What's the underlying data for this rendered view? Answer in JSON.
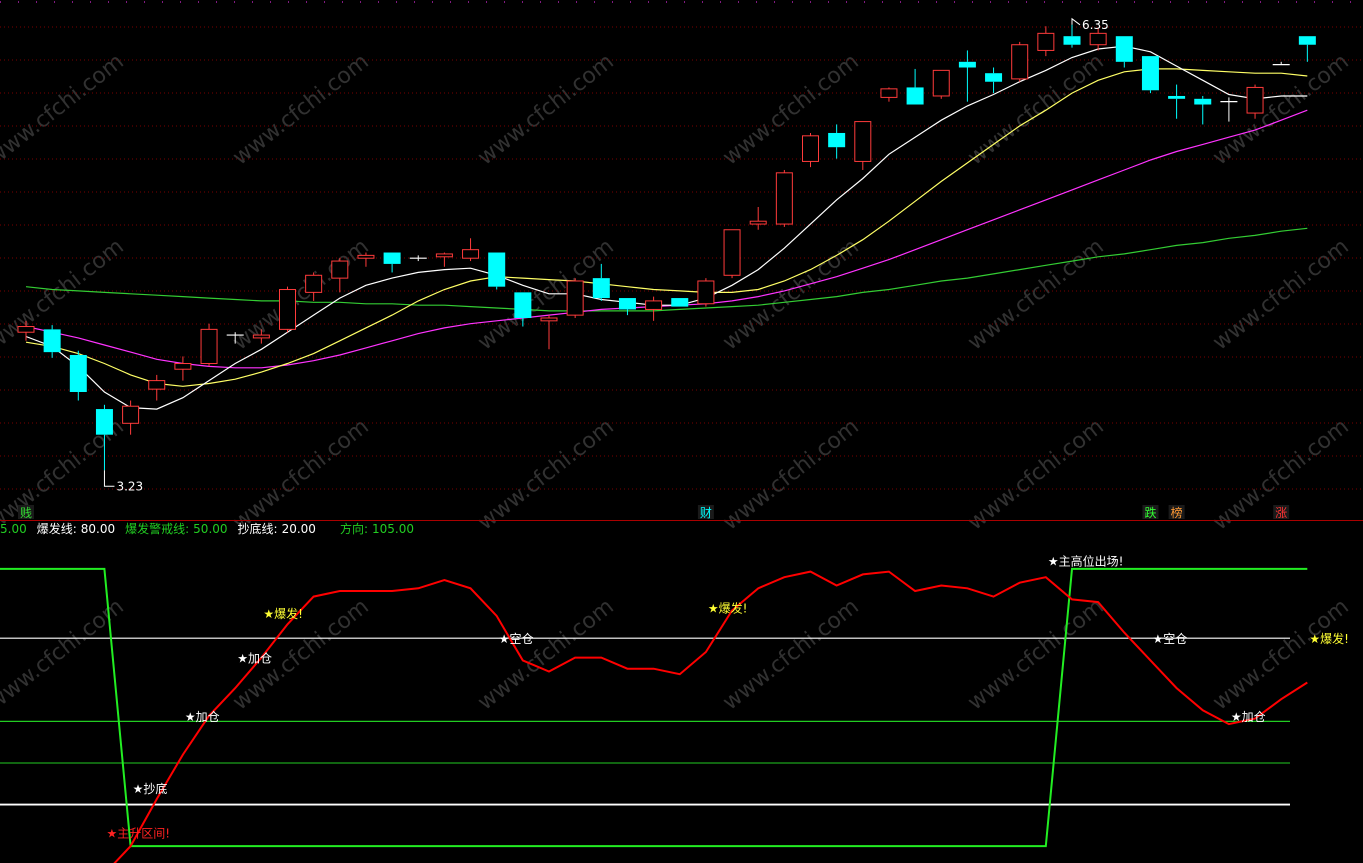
{
  "colors": {
    "background": "#000000",
    "grid": "#7a0000",
    "bull_candle": "#ff3b3b",
    "bear_candle": "#00ffff",
    "ma5": "#ffffff",
    "ma10": "#ffff66",
    "ma20": "#ff33ff",
    "ma60": "#33cc33",
    "indicator_line": "#ff0000",
    "direction_line": "#22ee22",
    "level_white": "#ffffff",
    "level_green": "#22cc22"
  },
  "watermark": "www.cfchi.com",
  "params": {
    "partial_prefix": "5.00",
    "burst_label": "爆发线:",
    "burst_value": "80.00",
    "warn_label": "爆发警戒线:",
    "warn_value": "50.00",
    "bottom_label": "抄底线:",
    "bottom_value": "20.00",
    "dir_label": "方向:",
    "dir_value": "105.00"
  },
  "chart_data": [
    {
      "type": "candlestick",
      "panel": "price",
      "max_label": "6.35",
      "min_label": "3.23",
      "ylim": [
        3.0,
        6.45
      ],
      "candles": [
        [
          4.2,
          4.28,
          4.14,
          4.24
        ],
        [
          4.22,
          4.25,
          4.02,
          4.06
        ],
        [
          4.04,
          4.07,
          3.72,
          3.78
        ],
        [
          3.66,
          3.69,
          3.23,
          3.48
        ],
        [
          3.56,
          3.72,
          3.48,
          3.68
        ],
        [
          3.8,
          3.9,
          3.72,
          3.86
        ],
        [
          3.94,
          4.03,
          3.86,
          3.98
        ],
        [
          3.98,
          4.26,
          3.96,
          4.22
        ],
        [
          4.18,
          4.2,
          4.12,
          4.18
        ],
        [
          4.16,
          4.22,
          4.12,
          4.18
        ],
        [
          4.22,
          4.52,
          4.2,
          4.5
        ],
        [
          4.48,
          4.62,
          4.42,
          4.6
        ],
        [
          4.58,
          4.72,
          4.48,
          4.7
        ],
        [
          4.72,
          4.76,
          4.66,
          4.74
        ],
        [
          4.76,
          4.76,
          4.62,
          4.68
        ],
        [
          4.72,
          4.74,
          4.7,
          4.72
        ],
        [
          4.73,
          4.76,
          4.66,
          4.75
        ],
        [
          4.72,
          4.86,
          4.7,
          4.78
        ],
        [
          4.76,
          4.76,
          4.5,
          4.52
        ],
        [
          4.48,
          4.48,
          4.24,
          4.3
        ],
        [
          4.28,
          4.32,
          4.08,
          4.3
        ],
        [
          4.32,
          4.58,
          4.3,
          4.56
        ],
        [
          4.58,
          4.68,
          4.42,
          4.44
        ],
        [
          4.44,
          4.44,
          4.32,
          4.36
        ],
        [
          4.36,
          4.45,
          4.28,
          4.42
        ],
        [
          4.44,
          4.44,
          4.38,
          4.38
        ],
        [
          4.4,
          4.58,
          4.38,
          4.56
        ],
        [
          4.6,
          4.92,
          4.58,
          4.92
        ],
        [
          4.96,
          5.08,
          4.92,
          4.98
        ],
        [
          4.96,
          5.34,
          4.94,
          5.32
        ],
        [
          5.4,
          5.6,
          5.36,
          5.58
        ],
        [
          5.6,
          5.66,
          5.42,
          5.5
        ],
        [
          5.4,
          5.68,
          5.34,
          5.68
        ],
        [
          5.85,
          5.92,
          5.82,
          5.91
        ],
        [
          5.92,
          6.05,
          5.9,
          5.8
        ],
        [
          5.86,
          6.02,
          5.84,
          6.04
        ],
        [
          6.1,
          6.18,
          5.82,
          6.06
        ],
        [
          6.02,
          6.06,
          5.88,
          5.96
        ],
        [
          5.98,
          6.24,
          5.96,
          6.22
        ],
        [
          6.18,
          6.35,
          6.14,
          6.3
        ],
        [
          6.28,
          6.36,
          6.2,
          6.22
        ],
        [
          6.22,
          6.34,
          6.18,
          6.3
        ],
        [
          6.28,
          6.28,
          6.06,
          6.1
        ],
        [
          6.14,
          6.14,
          5.88,
          5.9
        ],
        [
          5.86,
          5.94,
          5.7,
          5.84
        ],
        [
          5.84,
          5.86,
          5.66,
          5.8
        ],
        [
          5.82,
          5.85,
          5.68,
          5.82
        ],
        [
          5.74,
          5.94,
          5.7,
          5.92
        ],
        [
          6.08,
          6.1,
          6.08,
          6.08
        ],
        [
          6.28,
          6.28,
          6.1,
          6.22
        ]
      ],
      "ma5": [
        4.17,
        4.1,
        3.96,
        3.78,
        3.67,
        3.66,
        3.74,
        3.86,
        3.98,
        4.08,
        4.2,
        4.32,
        4.44,
        4.53,
        4.58,
        4.62,
        4.64,
        4.65,
        4.6,
        4.53,
        4.47,
        4.47,
        4.43,
        4.41,
        4.39,
        4.39,
        4.44,
        4.53,
        4.64,
        4.79,
        4.96,
        5.13,
        5.28,
        5.45,
        5.57,
        5.69,
        5.79,
        5.87,
        5.96,
        6.04,
        6.13,
        6.19,
        6.21,
        6.17,
        6.07,
        5.97,
        5.87,
        5.84,
        5.86,
        5.86
      ],
      "ma10": [
        4.13,
        4.1,
        4.05,
        3.98,
        3.9,
        3.84,
        3.82,
        3.84,
        3.87,
        3.92,
        3.98,
        4.05,
        4.14,
        4.23,
        4.32,
        4.42,
        4.5,
        4.56,
        4.59,
        4.58,
        4.57,
        4.56,
        4.54,
        4.52,
        4.5,
        4.49,
        4.48,
        4.48,
        4.5,
        4.56,
        4.64,
        4.74,
        4.85,
        4.98,
        5.12,
        5.26,
        5.39,
        5.52,
        5.65,
        5.76,
        5.88,
        5.97,
        6.03,
        6.05,
        6.05,
        6.04,
        6.03,
        6.02,
        6.02,
        6.0
      ],
      "ma20": [
        4.24,
        4.2,
        4.16,
        4.11,
        4.06,
        4.01,
        3.98,
        3.96,
        3.95,
        3.95,
        3.97,
        4.0,
        4.04,
        4.09,
        4.14,
        4.19,
        4.23,
        4.26,
        4.28,
        4.3,
        4.32,
        4.34,
        4.36,
        4.37,
        4.38,
        4.39,
        4.4,
        4.42,
        4.45,
        4.49,
        4.54,
        4.59,
        4.65,
        4.71,
        4.78,
        4.85,
        4.92,
        4.99,
        5.06,
        5.13,
        5.2,
        5.27,
        5.34,
        5.41,
        5.47,
        5.52,
        5.57,
        5.62,
        5.69,
        5.76
      ],
      "ma60": [
        4.52,
        4.5,
        4.49,
        4.48,
        4.47,
        4.46,
        4.45,
        4.44,
        4.43,
        4.42,
        4.42,
        4.41,
        4.41,
        4.4,
        4.4,
        4.39,
        4.39,
        4.38,
        4.37,
        4.36,
        4.35,
        4.35,
        4.35,
        4.35,
        4.35,
        4.36,
        4.37,
        4.38,
        4.39,
        4.41,
        4.43,
        4.45,
        4.48,
        4.5,
        4.53,
        4.56,
        4.58,
        4.61,
        4.64,
        4.67,
        4.7,
        4.73,
        4.75,
        4.78,
        4.81,
        4.83,
        4.86,
        4.88,
        4.91,
        4.93
      ],
      "markers": [
        {
          "label": "贱",
          "candle": 0,
          "color": "#33dd33"
        },
        {
          "label": "财",
          "candle": 26,
          "color": "#00ffff"
        },
        {
          "label": "跌",
          "candle": 43,
          "color": "#33ff33"
        },
        {
          "label": "榜",
          "candle": 44,
          "color": "#ff9933"
        },
        {
          "label": "涨",
          "candle": 48,
          "color": "#ff3333"
        }
      ]
    },
    {
      "type": "line",
      "panel": "indicator",
      "ylim": [
        0,
        110
      ],
      "series": [
        {
          "name": "爆发线",
          "values": [
            80
          ],
          "style": "hline"
        },
        {
          "name": "爆发警戒线",
          "values": [
            50
          ],
          "style": "hline"
        },
        {
          "name": "抄底线",
          "values": [
            20
          ],
          "style": "hline"
        },
        {
          "name": "方向",
          "values": [
            105,
            105,
            105,
            105,
            5,
            5,
            5,
            5,
            5,
            5,
            5,
            5,
            5,
            5,
            5,
            5,
            5,
            5,
            5,
            5,
            5,
            5,
            5,
            5,
            5,
            5,
            5,
            5,
            5,
            5,
            5,
            5,
            5,
            5,
            5,
            5,
            5,
            5,
            5,
            5,
            105,
            105,
            105,
            105,
            105,
            105,
            105,
            105,
            105,
            105
          ]
        },
        {
          "name": "",
          "values": [
            -12,
            -16,
            -12,
            -5,
            5,
            22,
            38,
            52,
            62,
            73,
            85,
            95,
            97,
            97,
            97,
            98,
            101,
            98,
            88,
            72,
            68,
            73,
            73,
            69,
            69,
            67,
            75,
            90,
            98,
            102,
            104,
            99,
            103,
            104,
            97,
            99,
            98,
            95,
            100,
            102,
            94,
            93,
            82,
            72,
            62,
            54,
            49,
            51,
            58,
            64
          ]
        }
      ],
      "annotations": [
        {
          "label": "★抄底",
          "candle": 4,
          "value": 26,
          "color": "#ffffff"
        },
        {
          "label": "★主升区间!",
          "candle": 3,
          "value": 10,
          "color": "#ff2222"
        },
        {
          "label": "★加仓",
          "candle": 6,
          "value": 52,
          "color": "#ffffff"
        },
        {
          "label": "★加仓",
          "candle": 8,
          "value": 73,
          "color": "#ffffff"
        },
        {
          "label": "★爆发!",
          "candle": 9,
          "value": 89,
          "color": "#ffff33"
        },
        {
          "label": "★空仓",
          "candle": 18,
          "value": 80,
          "color": "#ffffff"
        },
        {
          "label": "★爆发!",
          "candle": 26,
          "value": 91,
          "color": "#ffff33"
        },
        {
          "label": "★主高位出场!",
          "candle": 39,
          "value": 108,
          "color": "#ffffff"
        },
        {
          "label": "★空仓",
          "candle": 43,
          "value": 80,
          "color": "#ffffff"
        },
        {
          "label": "★加仓",
          "candle": 46,
          "value": 52,
          "color": "#ffffff"
        },
        {
          "label": "★爆发!",
          "candle": 49,
          "value": 80,
          "color": "#ffff33"
        }
      ]
    }
  ]
}
